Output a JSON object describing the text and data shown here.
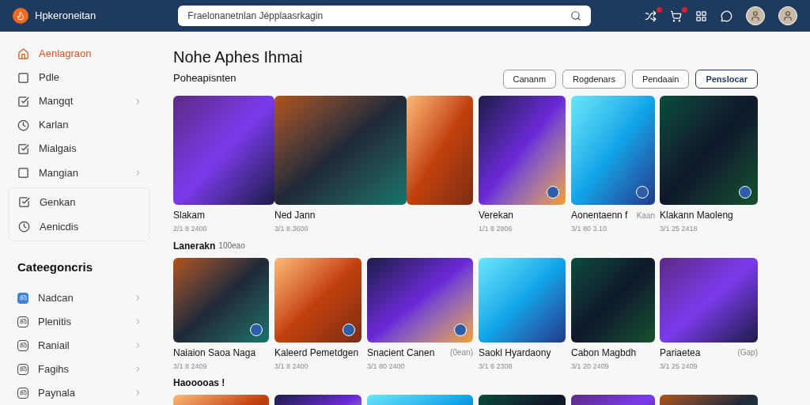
{
  "header": {
    "logo": "Hpkeroneitan",
    "search": {
      "value": "Fraelonanetnlan Jépplaasrkagin"
    },
    "actions": [
      {
        "kind": "shuffle",
        "badge": true
      },
      {
        "kind": "cart",
        "badge": true
      },
      {
        "kind": "grid",
        "badge": false
      },
      {
        "kind": "chat",
        "badge": false
      },
      {
        "kind": "avatar"
      },
      {
        "kind": "avatar"
      }
    ]
  },
  "sidebar": {
    "nav": [
      {
        "label": "Aenlagraon",
        "selected": true,
        "expandable": false
      },
      {
        "label": "Pdle",
        "selected": false,
        "expandable": false
      },
      {
        "label": "Mangqt",
        "selected": false,
        "expandable": true
      },
      {
        "label": "Karlan",
        "selected": false,
        "expandable": false
      },
      {
        "label": "Mialgais",
        "selected": false,
        "expandable": false
      },
      {
        "label": "Mangian",
        "selected": false,
        "expandable": true
      }
    ],
    "group": [
      {
        "label": "Genkan",
        "selected": false,
        "expandable": false
      },
      {
        "label": "Aenicdis",
        "selected": false,
        "expandable": false
      }
    ],
    "categories": {
      "title": "Cateegoncris",
      "items": [
        {
          "label": "Nadcan",
          "selected": true,
          "expandable": true
        },
        {
          "label": "Plenitis",
          "selected": false,
          "expandable": true
        },
        {
          "label": "Raniail",
          "selected": false,
          "expandable": true
        },
        {
          "label": "Fagihs",
          "selected": false,
          "expandable": true
        },
        {
          "label": "Paynala",
          "selected": false,
          "expandable": true
        }
      ]
    }
  },
  "main": {
    "title": "Nohe Aphes Ihmai",
    "subtitle": "Poheapisnten",
    "filters": [
      {
        "label": "Cananm",
        "selected": false
      },
      {
        "label": "Rogdenars",
        "selected": false
      },
      {
        "label": "Pendaain",
        "selected": false
      },
      {
        "label": "Penslocar",
        "selected": true
      }
    ],
    "sections": [
      {
        "cards": [
          {
            "title": "Slakam",
            "date": "2/1 8 2400",
            "badge": false
          },
          {
            "title": "Ned Jann",
            "date": "3/1 8.3600",
            "badge": false
          },
          {
            "badge": false
          },
          {
            "title": "Verekan",
            "date": "1/1 8 2806",
            "badge": true
          },
          {
            "title": "Aonentaenn f",
            "extra": "Kaan",
            "date": "3/1 80 3.10",
            "badge": true
          },
          {
            "title": "Klakann Maoleng",
            "date": "3/1 25 2418",
            "badge": true
          }
        ]
      },
      {
        "heading": "Lanerakn",
        "note": "100eao",
        "cards": [
          {
            "title": "Naiaion Saoa Naga",
            "date": "3/1 8 2409",
            "badge": true
          },
          {
            "title": "Kaleerd Pemetdgen",
            "date": "3/1 8 2400",
            "badge": true
          },
          {
            "title": "Snacient Canen",
            "extra": "(0ean)",
            "date": "3/1 80 2400",
            "badge": true
          },
          {
            "title": "Saokl Hyardaony",
            "date": "3/1 8 2308",
            "badge": false
          },
          {
            "title": "Cabon Magbdh",
            "date": "3/1 20 2409",
            "badge": false
          },
          {
            "title": "Pariaetea",
            "extra": "(Gap)",
            "date": "3/1 25 2409",
            "badge": false
          }
        ]
      },
      {
        "heading": "Haooooas !"
      }
    ]
  }
}
